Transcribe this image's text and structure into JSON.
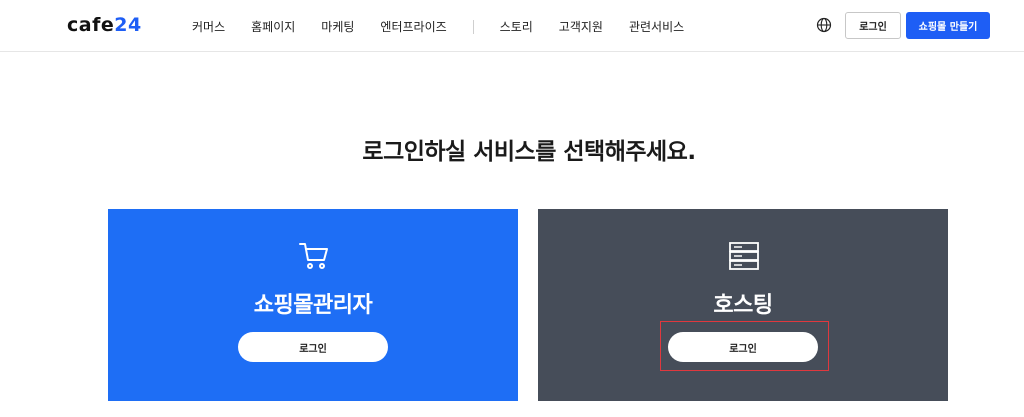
{
  "header": {
    "logo_text": "cafe",
    "logo_num": "24",
    "nav": [
      "커머스",
      "홈페이지",
      "마케팅",
      "엔터프라이즈"
    ],
    "nav_secondary": [
      "스토리",
      "고객지원",
      "관련서비스"
    ],
    "login_label": "로그인",
    "make_shop_label": "쇼핑몰 만들기"
  },
  "main": {
    "heading": "로그인하실 서비스를 선택해주세요.",
    "cards": [
      {
        "title": "쇼핑몰관리자",
        "button_label": "로그인",
        "icon": "cart-icon",
        "color": "#1e6ef5"
      },
      {
        "title": "호스팅",
        "button_label": "로그인",
        "icon": "server-icon",
        "color": "#464d59"
      }
    ]
  },
  "colors": {
    "accent": "#1e5ef5",
    "highlight": "#e0383e"
  }
}
